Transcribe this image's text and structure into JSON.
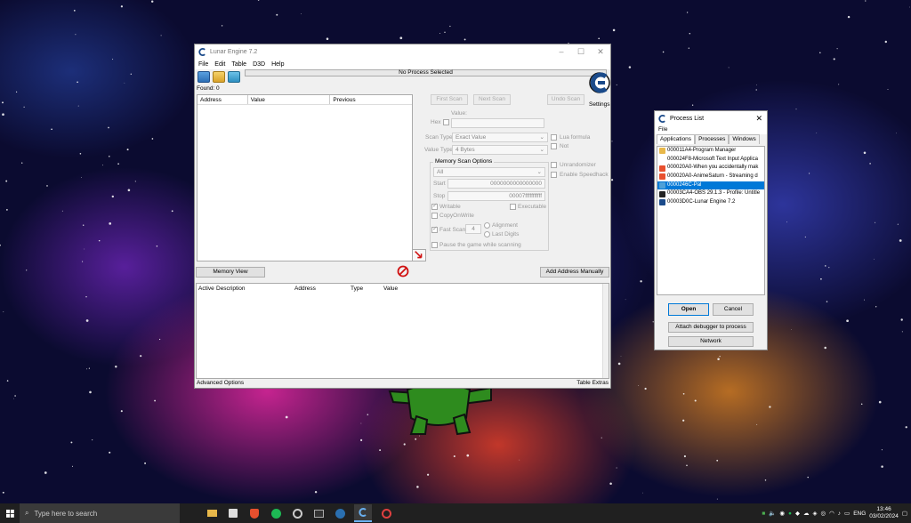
{
  "main_window": {
    "title": "Lunar Engine 7.2",
    "menu": [
      "File",
      "Edit",
      "Table",
      "D3D",
      "Help"
    ],
    "process_label": "No Process Selected",
    "found_label": "Found: 0",
    "results_columns": [
      "Address",
      "Value",
      "Previous"
    ],
    "buttons": {
      "first_scan": "First Scan",
      "next_scan": "Next Scan",
      "undo_scan": "Undo Scan",
      "settings": "Settings",
      "memory_view": "Memory View",
      "add_address": "Add Address Manually"
    },
    "value_label": "Value:",
    "hex_label": "Hex",
    "scan_type_label": "Scan Type",
    "scan_type_value": "Exact Value",
    "value_type_label": "Value Type",
    "value_type_value": "4 Bytes",
    "lua_formula": "Lua formula",
    "not_label": "Not",
    "memory_scan_options": "Memory Scan Options",
    "region_value": "All",
    "start_label": "Start",
    "start_value": "0000000000000000",
    "stop_label": "Stop",
    "stop_value": "00007fffffffffff",
    "writable": "Writable",
    "executable": "Executable",
    "copy_on_write": "CopyOnWrite",
    "fast_scan": "Fast Scan",
    "fast_scan_value": "4",
    "alignment": "Alignment",
    "last_digits": "Last Digits",
    "pause_game": "Pause the game while scanning",
    "unrandomizer": "Unrandomizer",
    "speedhack": "Enable Speedhack",
    "address_columns": [
      "Active",
      "Description",
      "Address",
      "Type",
      "Value"
    ],
    "advanced_options": "Advanced Options",
    "table_extras": "Table Extras"
  },
  "process_list": {
    "title": "Process List",
    "menu": "File",
    "tabs": [
      "Applications",
      "Processes",
      "Windows"
    ],
    "items": [
      {
        "label": "000011A4-Program Manager",
        "icon": "folder-icon",
        "color": "#e8b84a"
      },
      {
        "label": "000024F8-Microsoft Text Input Applica",
        "icon": "blank-icon",
        "color": "#ffffff"
      },
      {
        "label": "000020A0-When you accidentally mak",
        "icon": "brave-icon",
        "color": "#e8502e"
      },
      {
        "label": "000020A0-AnimeSaturn - Streaming d",
        "icon": "brave-icon",
        "color": "#e8502e"
      },
      {
        "label": "0000246C-Pal",
        "icon": "pal-icon",
        "color": "#4ea0d8"
      },
      {
        "label": "00003CA4-OBS 29.1.3 - Profile: Untitle",
        "icon": "obs-icon",
        "color": "#222222"
      },
      {
        "label": "00003D0C-Lunar Engine 7.2",
        "icon": "lunar-icon",
        "color": "#1a4a8a"
      }
    ],
    "selected_index": 4,
    "buttons": {
      "open": "Open",
      "cancel": "Cancel",
      "attach": "Attach debugger to process",
      "network": "Network"
    }
  },
  "taskbar": {
    "search_placeholder": "Type here to search",
    "language": "ENG",
    "time": "13:46",
    "date": "03/02/2024"
  },
  "colors": {
    "accent": "#0078d7",
    "taskbar": "#202020",
    "window_bg": "#f0f0f0"
  }
}
